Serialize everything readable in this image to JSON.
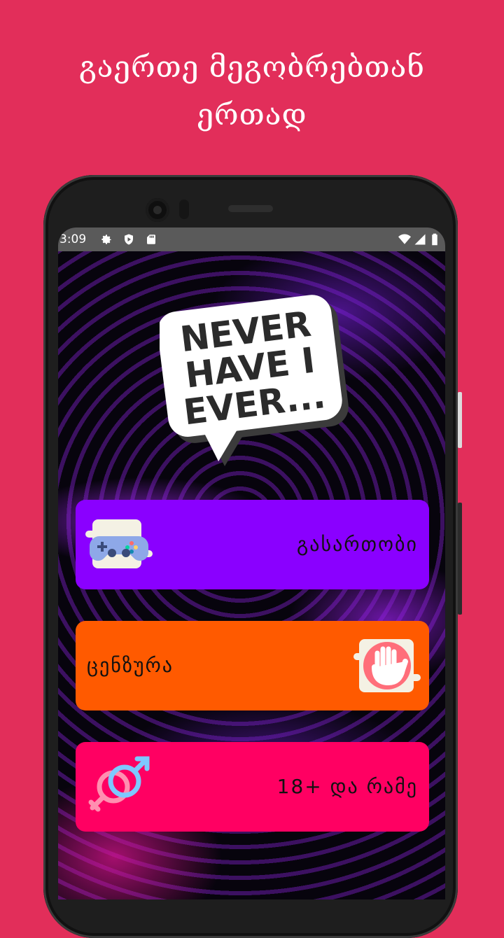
{
  "promo": {
    "headline_line1": "გაერთე მეგობრებთან",
    "headline_line2": "ერთად"
  },
  "status_bar": {
    "time": "3:09",
    "icons": [
      "settings-icon",
      "shield-play-icon",
      "sd-card-icon",
      "wifi-icon",
      "signal-icon",
      "battery-icon"
    ]
  },
  "app": {
    "logo_text": [
      "NEVER",
      "HAVE I",
      "EVER..."
    ],
    "buttons": [
      {
        "label": "გასართობი",
        "icon": "gamepad-icon",
        "color": "#8a00ff"
      },
      {
        "label": "ცენზურა",
        "icon": "stop-hand-icon",
        "color": "#ff5a00"
      },
      {
        "label": "18+ და რამე",
        "icon": "gender-symbols-icon",
        "color": "#ff0062"
      }
    ]
  },
  "colors": {
    "background": "#e22e5a"
  }
}
